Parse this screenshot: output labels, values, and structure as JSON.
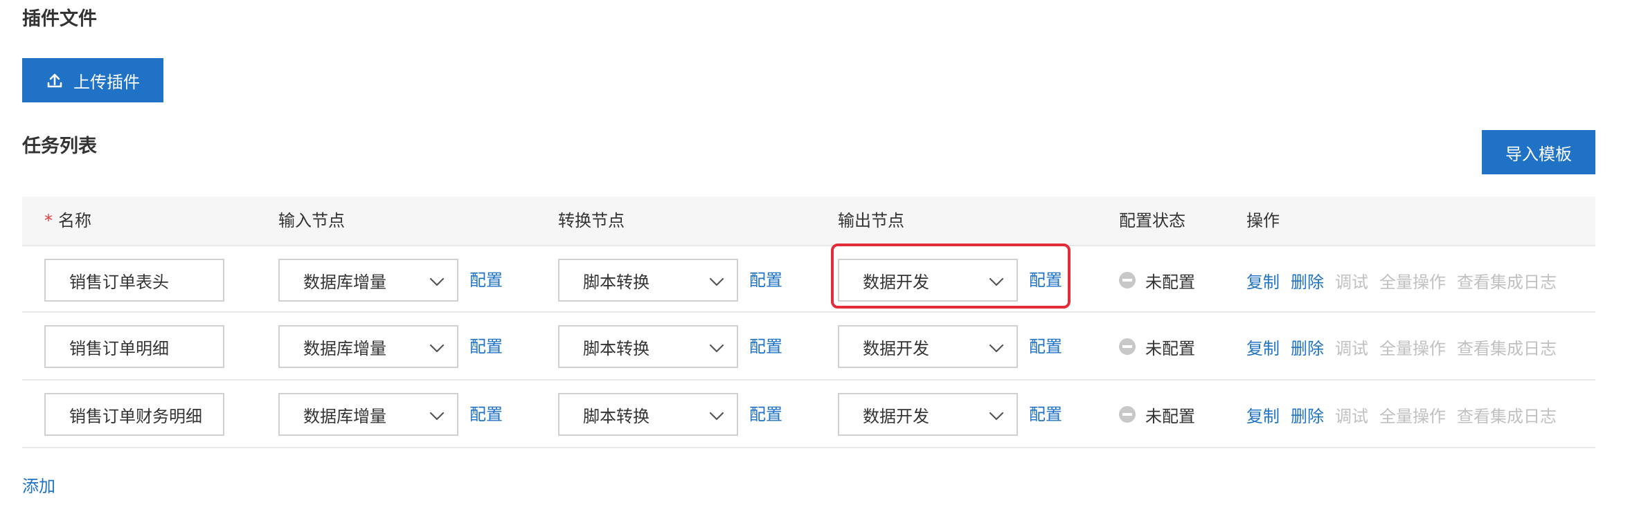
{
  "plugin_section": {
    "title": "插件文件",
    "upload_button": "上传插件"
  },
  "task_section": {
    "title": "任务列表",
    "import_button": "导入模板"
  },
  "table": {
    "headers": {
      "required_mark": "*",
      "name": "名称",
      "input_node": "输入节点",
      "transform_node": "转换节点",
      "output_node": "输出节点",
      "config_status": "配置状态",
      "actions": "操作"
    },
    "rows": [
      {
        "name": "销售订单表头",
        "input": "数据库增量",
        "input_config": "配置",
        "transform": "脚本转换",
        "transform_config": "配置",
        "output": "数据开发",
        "output_config": "配置",
        "status": "未配置",
        "actions": [
          "复制",
          "删除",
          "调试",
          "全量操作",
          "查看集成日志"
        ]
      },
      {
        "name": "销售订单明细",
        "input": "数据库增量",
        "input_config": "配置",
        "transform": "脚本转换",
        "transform_config": "配置",
        "output": "数据开发",
        "output_config": "配置",
        "status": "未配置",
        "actions": [
          "复制",
          "删除",
          "调试",
          "全量操作",
          "查看集成日志"
        ]
      },
      {
        "name": "销售订单财务明细",
        "input": "数据库增量",
        "input_config": "配置",
        "transform": "脚本转换",
        "transform_config": "配置",
        "output": "数据开发",
        "output_config": "配置",
        "status": "未配置",
        "actions": [
          "复制",
          "删除",
          "调试",
          "全量操作",
          "查看集成日志"
        ]
      }
    ]
  },
  "add_link": "添加",
  "colors": {
    "primary": "#1f72c5",
    "highlight": "#e22c3a",
    "required": "#e63a3a",
    "disabled": "#c0c0c0",
    "header_bg": "#f6f6f6"
  },
  "icons": {
    "upload": "upload-icon",
    "dropdown": "chevron-down-icon",
    "status": "minus-circle-icon"
  }
}
